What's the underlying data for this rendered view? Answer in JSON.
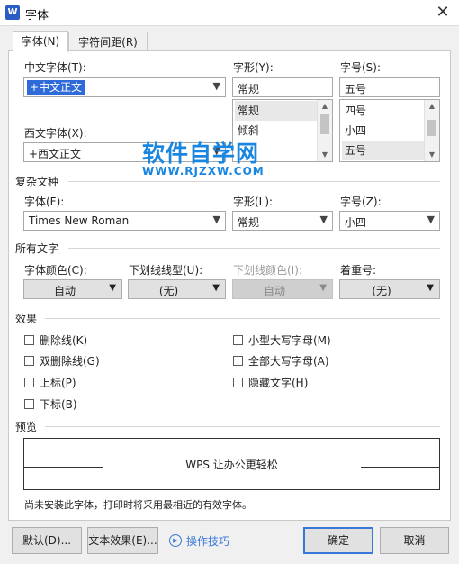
{
  "window": {
    "title": "字体",
    "app_icon": "W",
    "close": "✕"
  },
  "tabs": [
    {
      "label": "字体(N)",
      "active": true
    },
    {
      "label": "字符间距(R)",
      "active": false
    }
  ],
  "chinese_font": {
    "label": "中文字体(T):",
    "value": "+中文正文"
  },
  "western_font": {
    "label": "西文字体(X):",
    "value": "+西文正文"
  },
  "style": {
    "label": "字形(Y):",
    "value": "常规",
    "options": [
      "常规",
      "倾斜"
    ],
    "selected": "常规"
  },
  "size": {
    "label": "字号(S):",
    "value": "五号",
    "options": [
      "四号",
      "小四",
      "五号"
    ],
    "selected": "五号"
  },
  "complex_script": {
    "section": "复杂文种",
    "font_label": "字体(F):",
    "font_value": "Times New Roman",
    "style_label": "字形(L):",
    "style_value": "常规",
    "size_label": "字号(Z):",
    "size_value": "小四"
  },
  "all_text": {
    "section": "所有文字",
    "font_color_label": "字体颜色(C):",
    "font_color_value": "自动",
    "underline_type_label": "下划线线型(U):",
    "underline_type_value": "(无)",
    "underline_color_label": "下划线颜色(I):",
    "underline_color_value": "自动",
    "emphasis_label": "着重号:",
    "emphasis_value": "(无)"
  },
  "effects": {
    "section": "效果",
    "left": [
      "删除线(K)",
      "双删除线(G)",
      "上标(P)",
      "下标(B)"
    ],
    "right": [
      "小型大写字母(M)",
      "全部大写字母(A)",
      "隐藏文字(H)"
    ]
  },
  "preview": {
    "section": "预览",
    "sample": "WPS 让办公更轻松"
  },
  "note": "尚未安装此字体，打印时将采用最相近的有效字体。",
  "buttons": {
    "default": "默认(D)...",
    "text_effect": "文本效果(E)...",
    "tips": "操作技巧",
    "ok": "确定",
    "cancel": "取消"
  },
  "watermark": {
    "title": "软件自学网",
    "url": "WWW.RJZXW.COM"
  },
  "colors": {
    "accent": "#2f6ad9",
    "watermark": "#1a86e0"
  }
}
